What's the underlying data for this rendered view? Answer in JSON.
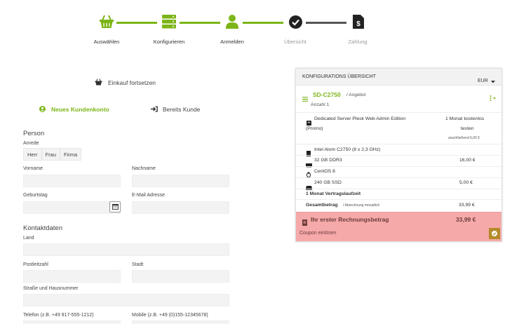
{
  "steps": [
    {
      "label": "Auswählen",
      "icon": "basket-icon",
      "state": "done"
    },
    {
      "label": "Konfigurieren",
      "icon": "server-icon",
      "state": "done"
    },
    {
      "label": "Anmelden",
      "icon": "user-icon",
      "state": "active"
    },
    {
      "label": "Übersicht",
      "icon": "check-circle-icon",
      "state": "pending"
    },
    {
      "label": "Zahlung",
      "icon": "invoice-icon",
      "state": "pending"
    }
  ],
  "colors": {
    "accent": "#7cb518",
    "dark": "#222222",
    "line_pending": "#555555",
    "danger_bg": "#f6a9a9",
    "coupon_btn": "#b58a2b"
  },
  "continue_shopping": "Einkauf fortsetzen",
  "tabs": {
    "new_account": "Neues Kundenkonto",
    "existing": "Bereits Kunde"
  },
  "form": {
    "person_title": "Person",
    "salutation_label": "Anrede",
    "salutations": [
      "Herr",
      "Frau",
      "Firma"
    ],
    "firstname_label": "Vorname",
    "lastname_label": "Nachname",
    "birthday_label": "Geburtstag",
    "email_label": "E-Mail Adresse",
    "contact_title": "Kontaktdaten",
    "country_label": "Land",
    "zip_label": "Postleitzahl",
    "city_label": "Stadt",
    "street_label": "Straße und Hausnummer",
    "phone_label": "Telefon (z.B. +49 917-555-1212)",
    "mobile_label": "Mobile (z.B. +49 (0)155-12345678)"
  },
  "summary": {
    "title": "KONFIGURATIONS ÜBERSICHT",
    "currency": "EUR",
    "product": "SD-C2750",
    "product_suffix": "/ Angebot",
    "quantity": "Anzahl 1",
    "plesk_line1": "Dedicated Server Plesk Web Admin Edition",
    "plesk_line2": "(Promo)",
    "plesk_price1": "1  Monat kostenlos",
    "plesk_price2": "testen",
    "plesk_after": "anschließend 6,00 €",
    "cpu": "Intel Atom C2750 (8 x 2,3 GHz)",
    "ram": "32 GB DDR3",
    "ram_price": "16,00 €",
    "os": "CentOS 8",
    "ssd": "240 GB SSD",
    "ssd_price": "5,00 €",
    "term": "1  Monat  Vertragslaufzeit",
    "total_label": "Gesamtbetrag",
    "total_note": "/ Abrechnung monatlich",
    "total_price": "33,99 €",
    "first_invoice_label": "Ihr erster Rechnungsbetrag",
    "first_invoice_price": "33,99 €",
    "coupon": "Coupon einlösen"
  }
}
